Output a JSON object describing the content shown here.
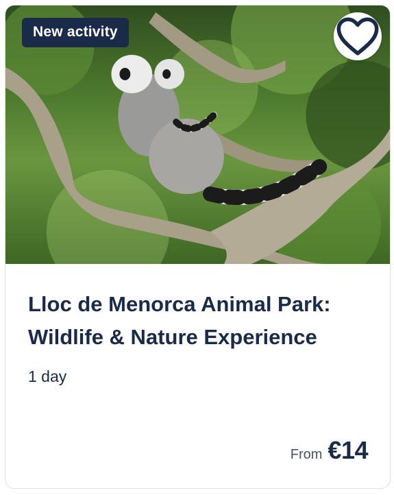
{
  "badge": {
    "label": "New activity"
  },
  "favorite": {
    "icon": "heart-outline-icon"
  },
  "photo": {
    "subject": "lemur-photo"
  },
  "activity": {
    "title": "Lloc de Menorca Animal Park: Wildlife & Nature Experience",
    "duration": "1 day"
  },
  "price": {
    "prefix": "From",
    "amount": "€14"
  },
  "colors": {
    "brand_navy": "#1a2b49",
    "border": "#dcdfe4",
    "muted_text": "#4a5468"
  }
}
